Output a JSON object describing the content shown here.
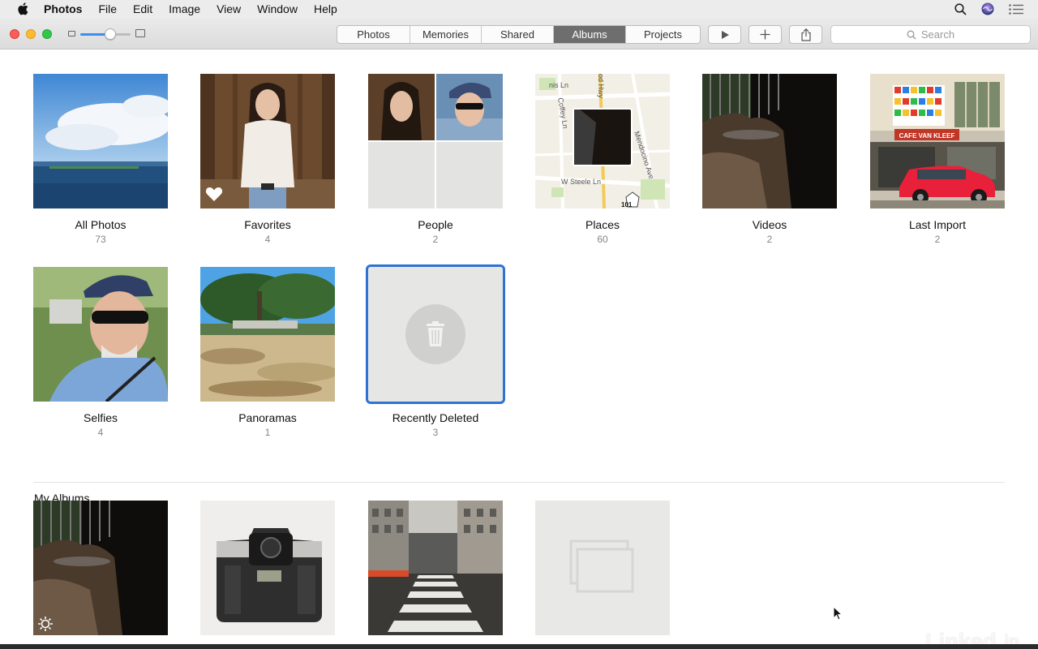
{
  "menubar": {
    "app": "Photos",
    "items": [
      "File",
      "Edit",
      "Image",
      "View",
      "Window",
      "Help"
    ]
  },
  "toolbar": {
    "tabs": [
      "Photos",
      "Memories",
      "Shared",
      "Albums",
      "Projects"
    ],
    "active_tab": "Albums",
    "search_placeholder": "Search",
    "zoom_level": 0.6
  },
  "albums": [
    {
      "title": "All Photos",
      "count": "73"
    },
    {
      "title": "Favorites",
      "count": "4"
    },
    {
      "title": "People",
      "count": "2"
    },
    {
      "title": "Places",
      "count": "60"
    },
    {
      "title": "Videos",
      "count": "2"
    },
    {
      "title": "Last Import",
      "count": "2"
    },
    {
      "title": "Selfies",
      "count": "4"
    },
    {
      "title": "Panoramas",
      "count": "1"
    },
    {
      "title": "Recently Deleted",
      "count": "3"
    }
  ],
  "map_labels": {
    "street1": "nis Ln",
    "street2": "Coffey Ln",
    "street3": "od Hwy",
    "street4": "Mendocino Ave",
    "street5": "W Steele Ln",
    "route": "101"
  },
  "storefront_sign": "CAFE VAN KLEEF",
  "my_albums": {
    "title": "My Albums"
  },
  "watermark": {
    "text": "Linked",
    "suffix": "in"
  },
  "colors": {
    "accent": "#2e73d2",
    "active_tab": "#6e6e6e"
  }
}
